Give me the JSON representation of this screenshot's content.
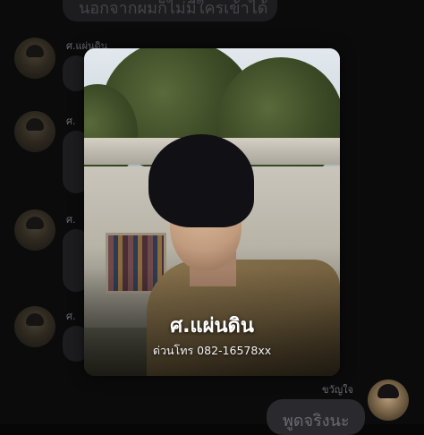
{
  "chat": {
    "messages_left": [
      {
        "sender": "",
        "text": "นอกจากผมก็ไม่มีใครเข้าได้"
      },
      {
        "sender": "ศ.แผ่นดิน",
        "text": ""
      },
      {
        "sender": "ศ.",
        "text": ""
      },
      {
        "sender": "ศ.",
        "text": ""
      },
      {
        "sender": "ศ.",
        "text": ""
      }
    ],
    "right_sender": "ขวัญใจ",
    "right_message": "พูดจริงนะ"
  },
  "profile_card": {
    "name": "ศ.แผ่นดิน",
    "phone": "ด่วนโทร 082-16578xx"
  }
}
